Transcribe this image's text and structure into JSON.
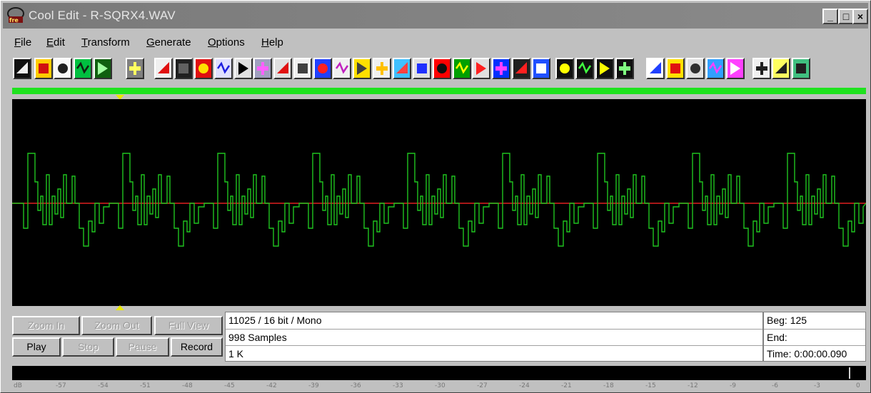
{
  "window": {
    "title": "Cool Edit - R-SQRX4.WAV",
    "minimize_label": "_",
    "maximize_label": "□",
    "close_label": "×"
  },
  "menu": [
    {
      "label": "File"
    },
    {
      "label": "Edit"
    },
    {
      "label": "Transform"
    },
    {
      "label": "Generate"
    },
    {
      "label": "Options"
    },
    {
      "label": "Help"
    }
  ],
  "toolbar": {
    "icons": [
      "new-icon",
      "open-icon",
      "save-icon",
      "film-icon",
      "insert-icon",
      "edit-icon",
      "rewind-icon",
      "stop-icon",
      "swap-icon",
      "note-icon",
      "record-dot-icon",
      "noise-icon",
      "download-icon",
      "timer-icon",
      "spectrum-icon",
      "echo-icon",
      "filter-icon",
      "envelope-icon",
      "wave-icon",
      "reverse-icon",
      "distortion-icon",
      "graphic-eq-icon",
      "level-icon",
      "flanger-icon",
      "compress-icon",
      "bend-icon",
      "cue-icon",
      "cue-add-icon",
      "cue-edit-icon",
      "cue-play-icon",
      "loop-icon",
      "color-icon",
      "text-icon",
      "transition-icon",
      "cursor-icon",
      "notepad-icon",
      "help-icon",
      "settings-icon"
    ]
  },
  "colors": {
    "waveform": "#1fc41f",
    "centerline": "#e02020",
    "progress_bar": "#1fe21f",
    "marker": "#e8e800"
  },
  "controls": {
    "zoom_in": "Zoom In",
    "zoom_out": "Zoom Out",
    "full_view": "Full View",
    "play": "Play",
    "stop": "Stop",
    "pause": "Pause",
    "record": "Record"
  },
  "info": {
    "format": "11025 / 16 bit / Mono",
    "samples": "998 Samples",
    "size": "1 K",
    "beg": "Beg: 125",
    "end": "End:",
    "time": "Time: 0:00:00.090"
  },
  "meter_scale": [
    "dB",
    "-57",
    "-54",
    "-51",
    "-48",
    "-45",
    "-42",
    "-39",
    "-36",
    "-33",
    "-30",
    "-27",
    "-24",
    "-21",
    "-18",
    "-15",
    "-12",
    "-9",
    "-6",
    "-3",
    "0"
  ]
}
